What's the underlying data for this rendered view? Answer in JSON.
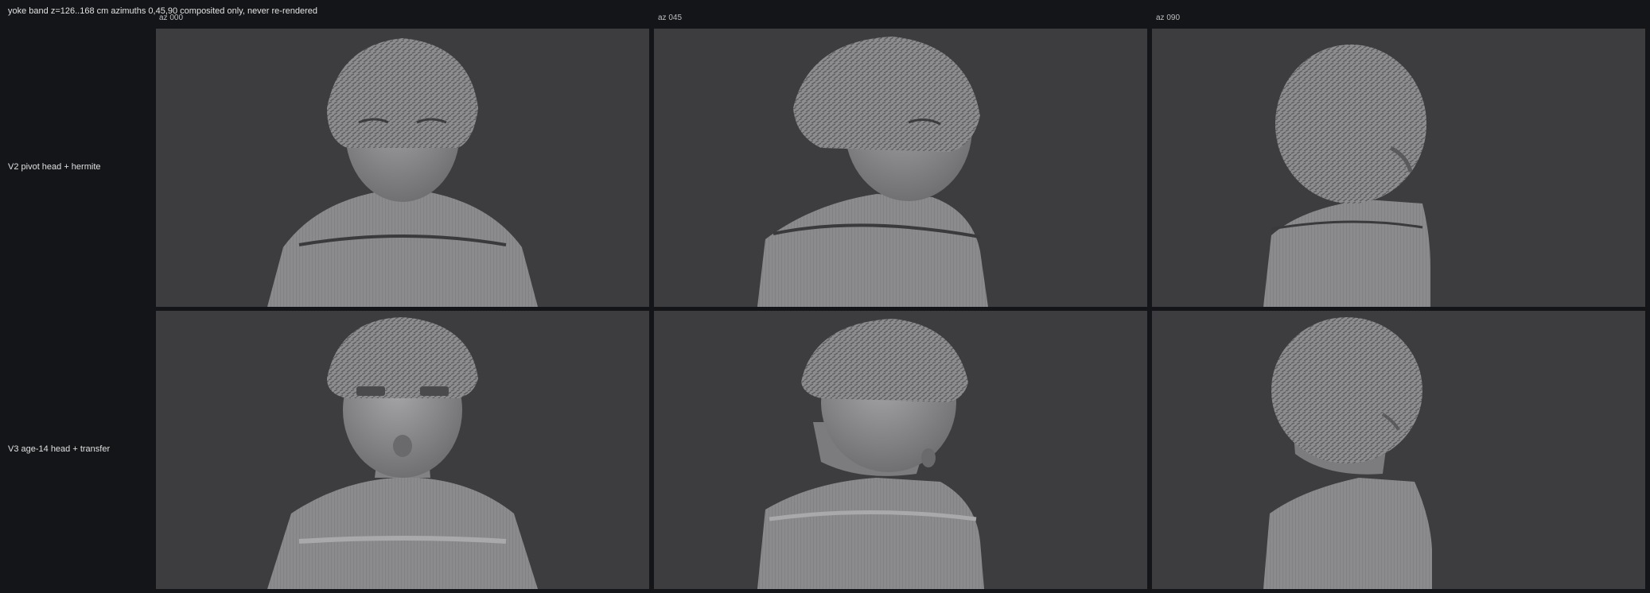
{
  "header": {
    "caption": "yoke band z=126..168 cm  azimuths 0,45,90  composited only, never re-rendered"
  },
  "columns": [
    {
      "label": "az 000"
    },
    {
      "label": "az 045"
    },
    {
      "label": "az 090"
    }
  ],
  "rows": [
    {
      "label": "V2 pivot head + hermite"
    },
    {
      "label": "V3 age-14 head + transfer"
    }
  ],
  "colors": {
    "page_background": "#141518",
    "panel_background": "#3d3d3f",
    "mesh_gray": "#8a8a8c"
  }
}
